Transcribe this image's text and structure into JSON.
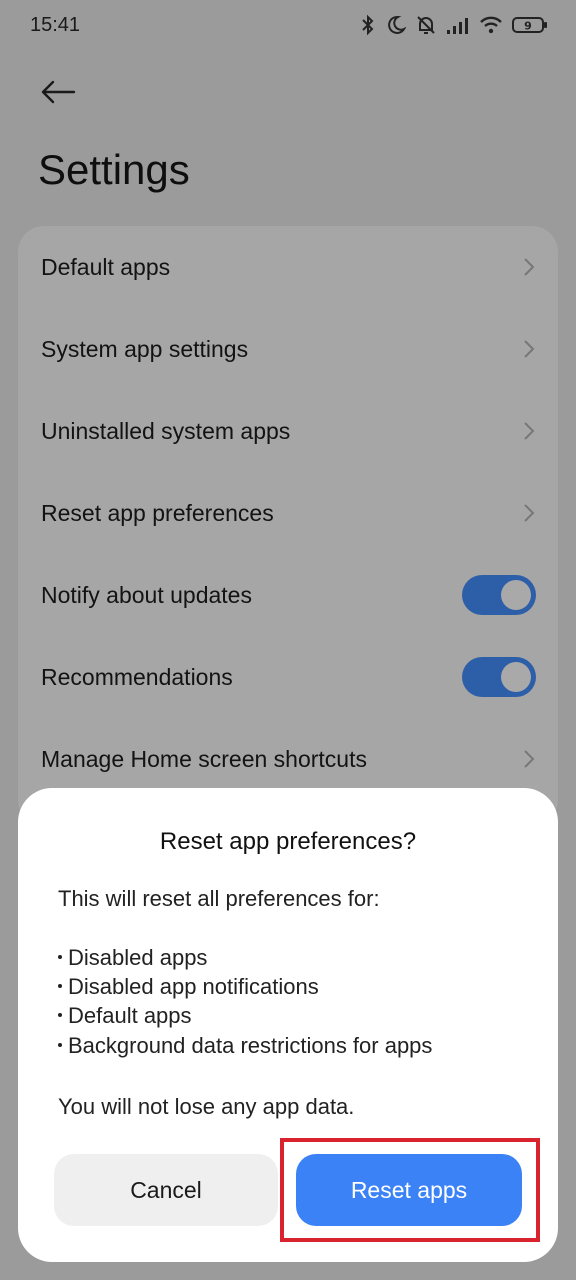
{
  "status": {
    "time": "15:41",
    "battery": "9"
  },
  "header": {
    "title": "Settings"
  },
  "settings": {
    "items": [
      {
        "label": "Default apps",
        "type": "link"
      },
      {
        "label": "System app settings",
        "type": "link"
      },
      {
        "label": "Uninstalled system apps",
        "type": "link"
      },
      {
        "label": "Reset app preferences",
        "type": "link"
      },
      {
        "label": "Notify about updates",
        "type": "toggle",
        "on": true
      },
      {
        "label": "Recommendations",
        "type": "toggle",
        "on": true
      },
      {
        "label": "Manage Home screen shortcuts",
        "type": "link"
      }
    ]
  },
  "dialog": {
    "title": "Reset app preferences?",
    "intro": "This will reset all preferences for:",
    "bullets": [
      "Disabled apps",
      "Disabled app notifications",
      "Default apps",
      "Background data restrictions for apps"
    ],
    "footer": "You will not lose any app data.",
    "cancel_label": "Cancel",
    "confirm_label": "Reset apps"
  },
  "colors": {
    "accent": "#3b82f6",
    "toggle_on": "#2d5ea8",
    "highlight": "#d9232e"
  }
}
